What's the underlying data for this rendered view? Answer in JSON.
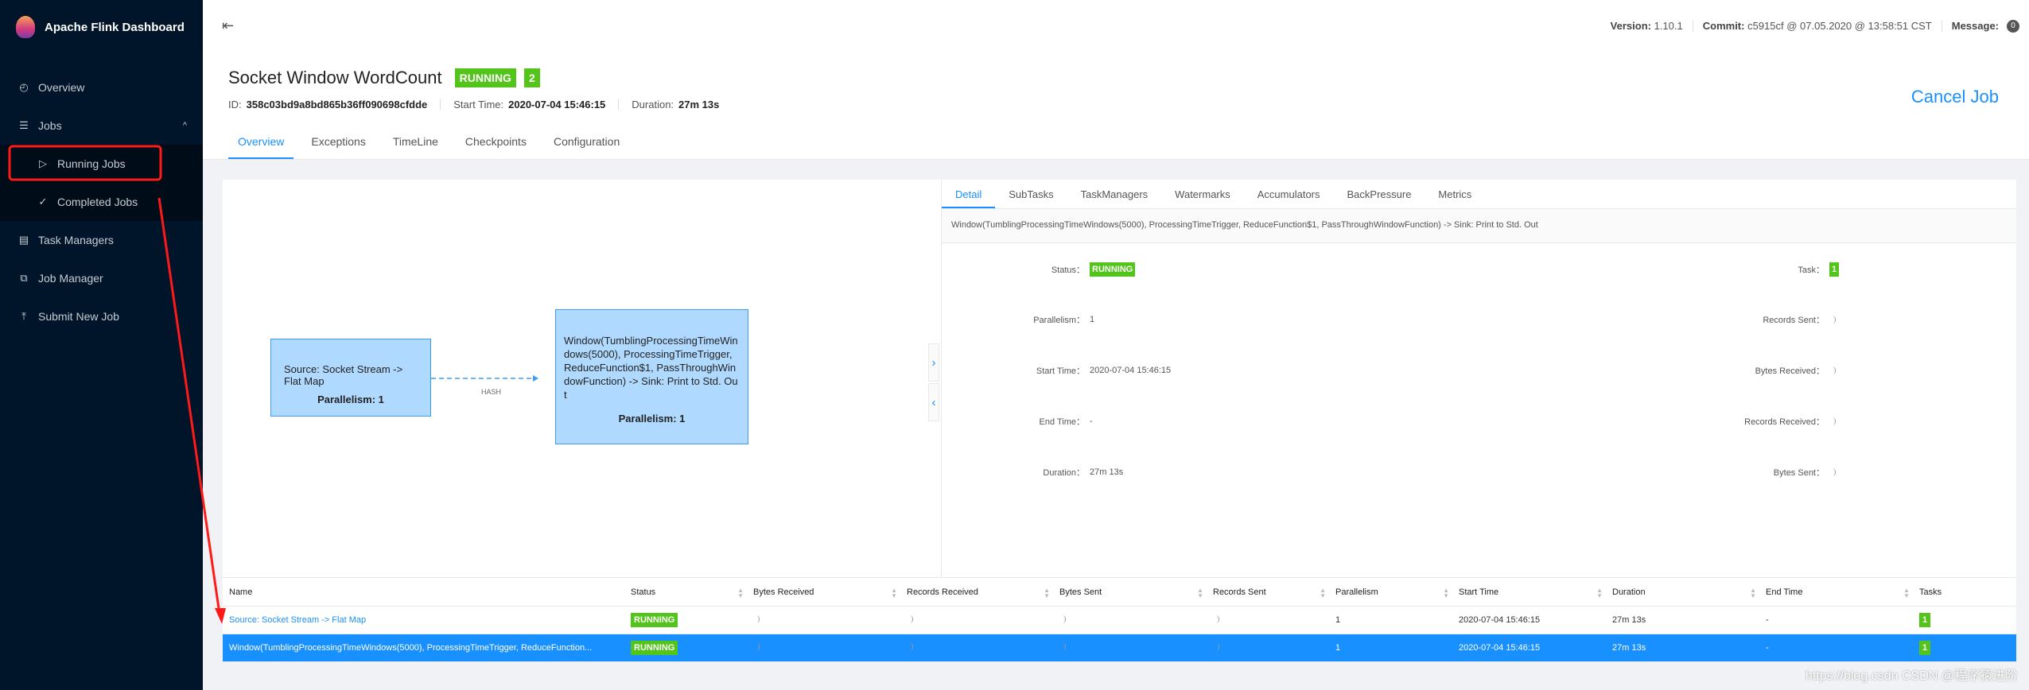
{
  "sidebar": {
    "title": "Apache Flink Dashboard",
    "items": [
      {
        "label": "Overview",
        "icon": "dashboard-icon"
      },
      {
        "label": "Jobs",
        "icon": "list-icon"
      },
      {
        "label": "Running Jobs",
        "icon": "play-circle-icon"
      },
      {
        "label": "Completed Jobs",
        "icon": "check-circle-icon"
      },
      {
        "label": "Task Managers",
        "icon": "schedule-icon"
      },
      {
        "label": "Job Manager",
        "icon": "cluster-icon"
      },
      {
        "label": "Submit New Job",
        "icon": "upload-icon"
      }
    ]
  },
  "header": {
    "version_label": "Version:",
    "version": "1.10.1",
    "commit_label": "Commit:",
    "commit": "c5915cf @ 07.05.2020 @ 13:58:51 CST",
    "message_label": "Message:",
    "message_count": "0"
  },
  "job": {
    "name": "Socket Window WordCount",
    "status": "RUNNING",
    "count": "2",
    "id_label": "ID:",
    "id": "358c03bd9a8bd865b36ff090698cfdde",
    "start_label": "Start Time:",
    "start": "2020-07-04 15:46:15",
    "duration_label": "Duration:",
    "duration": "27m 13s",
    "cancel": "Cancel Job",
    "tabs": [
      "Overview",
      "Exceptions",
      "TimeLine",
      "Checkpoints",
      "Configuration"
    ]
  },
  "graph": {
    "source": "Source: Socket Stream -> Flat Map",
    "source_par": "Parallelism: 1",
    "edge": "HASH",
    "window": "Window(TumblingProcessingTimeWindows(5000), ProcessingTimeTrigger, ReduceFunction$1, PassThroughWindowFunction) -> Sink: Print to Std. Out",
    "window_par": "Parallelism: 1"
  },
  "detail": {
    "tabs": [
      "Detail",
      "SubTasks",
      "TaskManagers",
      "Watermarks",
      "Accumulators",
      "BackPressure",
      "Metrics"
    ],
    "name": "Window(TumblingProcessingTimeWindows(5000), ProcessingTimeTrigger, ReduceFunction$1, PassThroughWindowFunction) -> Sink: Print to Std. Out",
    "left": [
      {
        "k": "Status：",
        "v": "RUNNING"
      },
      {
        "k": "Parallelism：",
        "v": "1"
      },
      {
        "k": "Start Time：",
        "v": "2020-07-04 15:46:15"
      },
      {
        "k": "End Time：",
        "v": "-"
      },
      {
        "k": "Duration：",
        "v": "27m 13s"
      }
    ],
    "right": [
      {
        "k": "Task：",
        "v": "1"
      },
      {
        "k": "Records Sent："
      },
      {
        "k": "Bytes Received："
      },
      {
        "k": "Records Received："
      },
      {
        "k": "Bytes Sent："
      }
    ]
  },
  "table": {
    "columns": [
      "Name",
      "Status",
      "Bytes Received",
      "Records Received",
      "Bytes Sent",
      "Records Sent",
      "Parallelism",
      "Start Time",
      "Duration",
      "End Time",
      "Tasks"
    ],
    "rows": [
      {
        "name": "Source: Socket Stream -> Flat Map",
        "status": "RUNNING",
        "parallelism": "1",
        "start": "2020-07-04 15:46:15",
        "duration": "27m 13s",
        "end": "-",
        "tasks": "1"
      },
      {
        "name": "Window(TumblingProcessingTimeWindows(5000), ProcessingTimeTrigger, ReduceFunction...",
        "status": "RUNNING",
        "parallelism": "1",
        "start": "2020-07-04 15:46:15",
        "duration": "27m 13s",
        "end": "-",
        "tasks": "1"
      }
    ]
  },
  "watermark": "https://blog.csdn CSDN @程序猿进阶",
  "colors": {
    "accent": "#1890ff",
    "running": "#52c41a",
    "sidebar": "#001529",
    "annotation": "#ff1a1a"
  }
}
